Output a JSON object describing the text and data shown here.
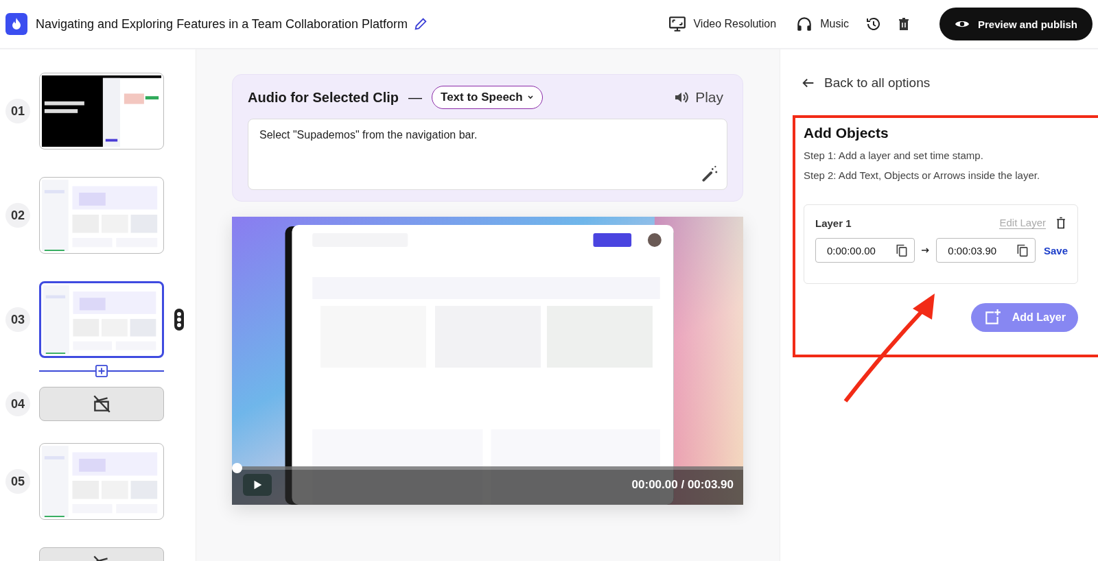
{
  "header": {
    "title": "Navigating and Exploring Features in a Team Collaboration Platform",
    "actions": [
      {
        "kind": "video",
        "label": "Video Resolution"
      },
      {
        "kind": "music",
        "label": "Music"
      },
      {
        "kind": "history"
      },
      {
        "kind": "delete"
      }
    ],
    "publish_button": "Preview and publish"
  },
  "clips": [
    {
      "number": "01",
      "kind": "picture",
      "selected": false
    },
    {
      "number": "02",
      "kind": "picture",
      "selected": false
    },
    {
      "number": "03",
      "kind": "picture",
      "selected": true
    },
    {
      "number": "04",
      "kind": "empty",
      "selected": false
    },
    {
      "number": "05",
      "kind": "picture",
      "selected": false
    },
    {
      "kind": "empty",
      "selected": false
    }
  ],
  "audio": {
    "title": "Audio for Selected Clip",
    "separator": "—",
    "source": "Text to Speech",
    "play": "Play",
    "script": "Select \"Supademos\" from the navigation bar."
  },
  "player": {
    "kind": "picture",
    "time": "00:00.00 / 00:03.90",
    "level": 0
  },
  "panel": {
    "back": "Back to all options",
    "title": "Add Objects",
    "steps": [
      "Step 1: Add a layer and set time stamp.",
      "Step 2: Add Text, Objects or Arrows inside the layer."
    ],
    "layers": [
      {
        "name": "Layer 1",
        "edit": "Edit Layer",
        "start": "0:00:00.00",
        "end": "0:00:03.90",
        "save": "Save"
      }
    ],
    "add_layer": "Add Layer"
  }
}
